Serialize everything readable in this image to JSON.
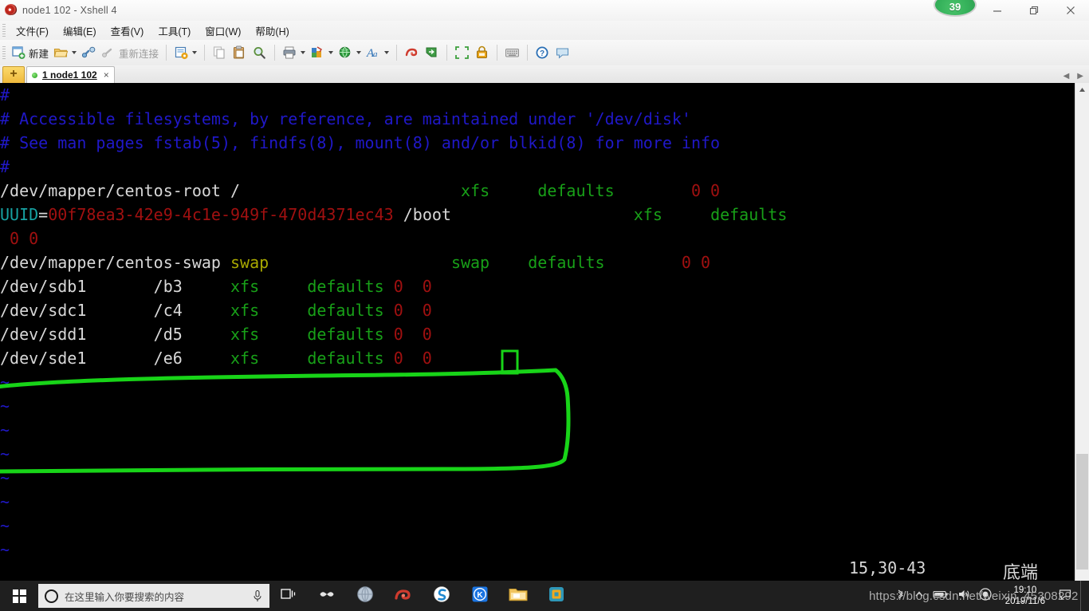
{
  "window": {
    "title": "node1 102 - Xshell 4",
    "app_icon": "snail-icon",
    "badge_count": "39",
    "minimize_label": "Minimize",
    "restore_label": "Restore",
    "close_label": "Close"
  },
  "menu": {
    "items": [
      {
        "label": "文件(F)",
        "name": "menu-file"
      },
      {
        "label": "编辑(E)",
        "name": "menu-edit"
      },
      {
        "label": "查看(V)",
        "name": "menu-view"
      },
      {
        "label": "工具(T)",
        "name": "menu-tools"
      },
      {
        "label": "窗口(W)",
        "name": "menu-window"
      },
      {
        "label": "帮助(H)",
        "name": "menu-help"
      }
    ]
  },
  "toolbar": {
    "new_label": "新建",
    "reconnect_label": "重新连接",
    "icons": [
      "new-session-icon",
      "open-folder-icon",
      "connect-link-icon",
      "reconnect-icon",
      "session-manager-icon",
      "copy-icon",
      "paste-icon",
      "find-icon",
      "print-icon",
      "color-scheme-icon",
      "web-transfer-icon",
      "font-icon",
      "xftp-icon",
      "xagent-icon",
      "fullscreen-icon",
      "lock-icon",
      "keyboard-icon",
      "help-icon",
      "feedback-icon"
    ]
  },
  "tabs": {
    "new_tab_label": "+",
    "items": [
      {
        "label": "1 node1 102",
        "close": "×",
        "status": "connected"
      }
    ]
  },
  "terminal": {
    "lines": [
      {
        "segments": [
          {
            "text": "#",
            "color": "comment"
          }
        ]
      },
      {
        "segments": [
          {
            "text": "# Accessible filesystems, by reference, are maintained under '/dev/disk'",
            "color": "comment"
          }
        ]
      },
      {
        "segments": [
          {
            "text": "# See man pages fstab(5), findfs(8), mount(8) and/or blkid(8) for more info",
            "color": "comment"
          }
        ]
      },
      {
        "segments": [
          {
            "text": "#",
            "color": "comment"
          }
        ]
      },
      {
        "segments": [
          {
            "text": "/dev/mapper/centos-root /",
            "color": "white"
          },
          {
            "text": "                       ",
            "color": "white"
          },
          {
            "text": "xfs     defaults",
            "color": "green"
          },
          {
            "text": "        ",
            "color": "white"
          },
          {
            "text": "0 0",
            "color": "red"
          }
        ]
      },
      {
        "segments": [
          {
            "text": "UUID",
            "color": "cyan"
          },
          {
            "text": "=",
            "color": "white"
          },
          {
            "text": "00f78ea3-42e9-4c1e-949f-470d4371ec43",
            "color": "red"
          },
          {
            "text": " /boot",
            "color": "white"
          },
          {
            "text": "                   ",
            "color": "white"
          },
          {
            "text": "xfs     defaults",
            "color": "green"
          }
        ]
      },
      {
        "segments": [
          {
            "text": " 0 0",
            "color": "red"
          }
        ]
      },
      {
        "segments": [
          {
            "text": "/dev/mapper/centos-swap ",
            "color": "white"
          },
          {
            "text": "swap",
            "color": "yellow"
          },
          {
            "text": "                   ",
            "color": "white"
          },
          {
            "text": "swap    defaults",
            "color": "green"
          },
          {
            "text": "        ",
            "color": "white"
          },
          {
            "text": "0 0",
            "color": "red"
          }
        ]
      },
      {
        "segments": [
          {
            "text": "/dev/sdb1       /b3     ",
            "color": "white"
          },
          {
            "text": "xfs     defaults ",
            "color": "green"
          },
          {
            "text": "0  0",
            "color": "red"
          }
        ]
      },
      {
        "segments": [
          {
            "text": "/dev/sdc1       /c4     ",
            "color": "white"
          },
          {
            "text": "xfs     defaults ",
            "color": "green"
          },
          {
            "text": "0  0",
            "color": "red"
          }
        ]
      },
      {
        "segments": [
          {
            "text": "/dev/sdd1       /d5     ",
            "color": "white"
          },
          {
            "text": "xfs     defaults ",
            "color": "green"
          },
          {
            "text": "0  0",
            "color": "red"
          }
        ]
      },
      {
        "segments": [
          {
            "text": "/dev/sde1       /e6     ",
            "color": "white"
          },
          {
            "text": "xfs     defaults ",
            "color": "green"
          },
          {
            "text": "0  0",
            "color": "red"
          }
        ]
      },
      {
        "segments": [
          {
            "text": "~",
            "color": "tilde"
          }
        ]
      },
      {
        "segments": [
          {
            "text": "~",
            "color": "tilde"
          }
        ]
      },
      {
        "segments": [
          {
            "text": "~",
            "color": "tilde"
          }
        ]
      },
      {
        "segments": [
          {
            "text": "~",
            "color": "tilde"
          }
        ]
      },
      {
        "segments": [
          {
            "text": "~",
            "color": "tilde"
          }
        ]
      },
      {
        "segments": [
          {
            "text": "~",
            "color": "tilde"
          }
        ]
      },
      {
        "segments": [
          {
            "text": "~",
            "color": "tilde"
          }
        ]
      },
      {
        "segments": [
          {
            "text": "~",
            "color": "tilde"
          }
        ]
      }
    ],
    "status_position": "15,30-43",
    "status_state": "底端",
    "annotation_color": "#18d418",
    "cursor_color": "#18d418"
  },
  "scrollbar": {
    "up_arrow": "▲",
    "down_arrow": "▼"
  },
  "taskbar": {
    "start_label": "Start",
    "search_placeholder": "在这里输入你要搜索的内容",
    "mic_icon": "microphone-icon",
    "taskview_icon": "task-view-icon",
    "apps": [
      {
        "name": "pinwheel-icon"
      },
      {
        "name": "globe-icon"
      },
      {
        "name": "xshell-icon"
      },
      {
        "name": "sogou-icon"
      },
      {
        "name": "wps-icon"
      },
      {
        "name": "file-explorer-icon"
      },
      {
        "name": "vmware-icon"
      }
    ],
    "tray_icons": [
      "bluetooth-icon",
      "show-hidden-icon",
      "battery-icon",
      "volume-icon",
      "network-icon"
    ],
    "clock_time": "19:10",
    "clock_date": "2019/11/6",
    "notification_icon": "notifications-icon"
  },
  "watermark": "https://blog.csdn.net/weixin_45308292"
}
